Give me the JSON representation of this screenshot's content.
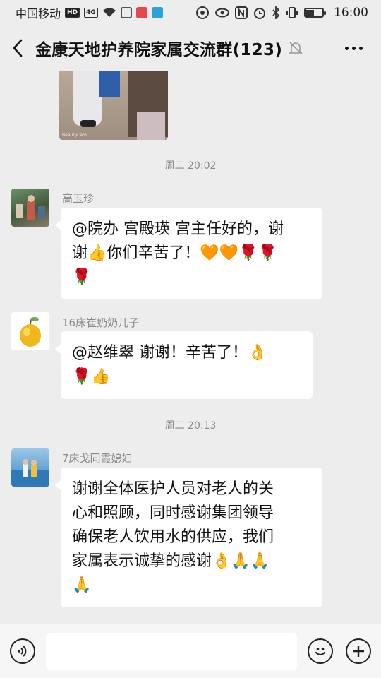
{
  "status_bar": {
    "carrier": "中国移动",
    "hd_badge": "HD",
    "net_badge": "4G",
    "time": "16:00",
    "battery_level": 0.45
  },
  "header": {
    "title": "金康天地护养院家属交流群(123)",
    "back_icon": "chevron-left-icon",
    "mute_icon": "bell-off-icon",
    "more_icon": "more-dots-icon"
  },
  "chat": {
    "photo_watermark": "BeautyCam",
    "timestamps": [
      "周二 20:02",
      "周二 20:13"
    ],
    "messages": [
      {
        "sender": "高玉珍",
        "lines": [
          "@院办 宫殿瑛  宫主任好的，谢",
          "谢👍你们辛苦了！🧡🧡🌹🌹",
          "🌹"
        ]
      },
      {
        "sender": "16床崔奶奶儿子",
        "lines": [
          "@赵维翠  谢谢！辛苦了！👌",
          "🌹👍"
        ]
      },
      {
        "sender": "7床戈同霞媳妇",
        "lines": [
          "谢谢全体医护人员对老人的关",
          "心和照顾，同时感谢集团领导",
          "确保老人饮用水的供应，我们",
          "家属表示诚挚的感谢👌🙏🙏",
          "🙏"
        ]
      }
    ]
  },
  "input_bar": {
    "voice_icon": "voice-icon",
    "emoji_icon": "smiley-icon",
    "plus_icon": "plus-icon",
    "input_value": ""
  }
}
